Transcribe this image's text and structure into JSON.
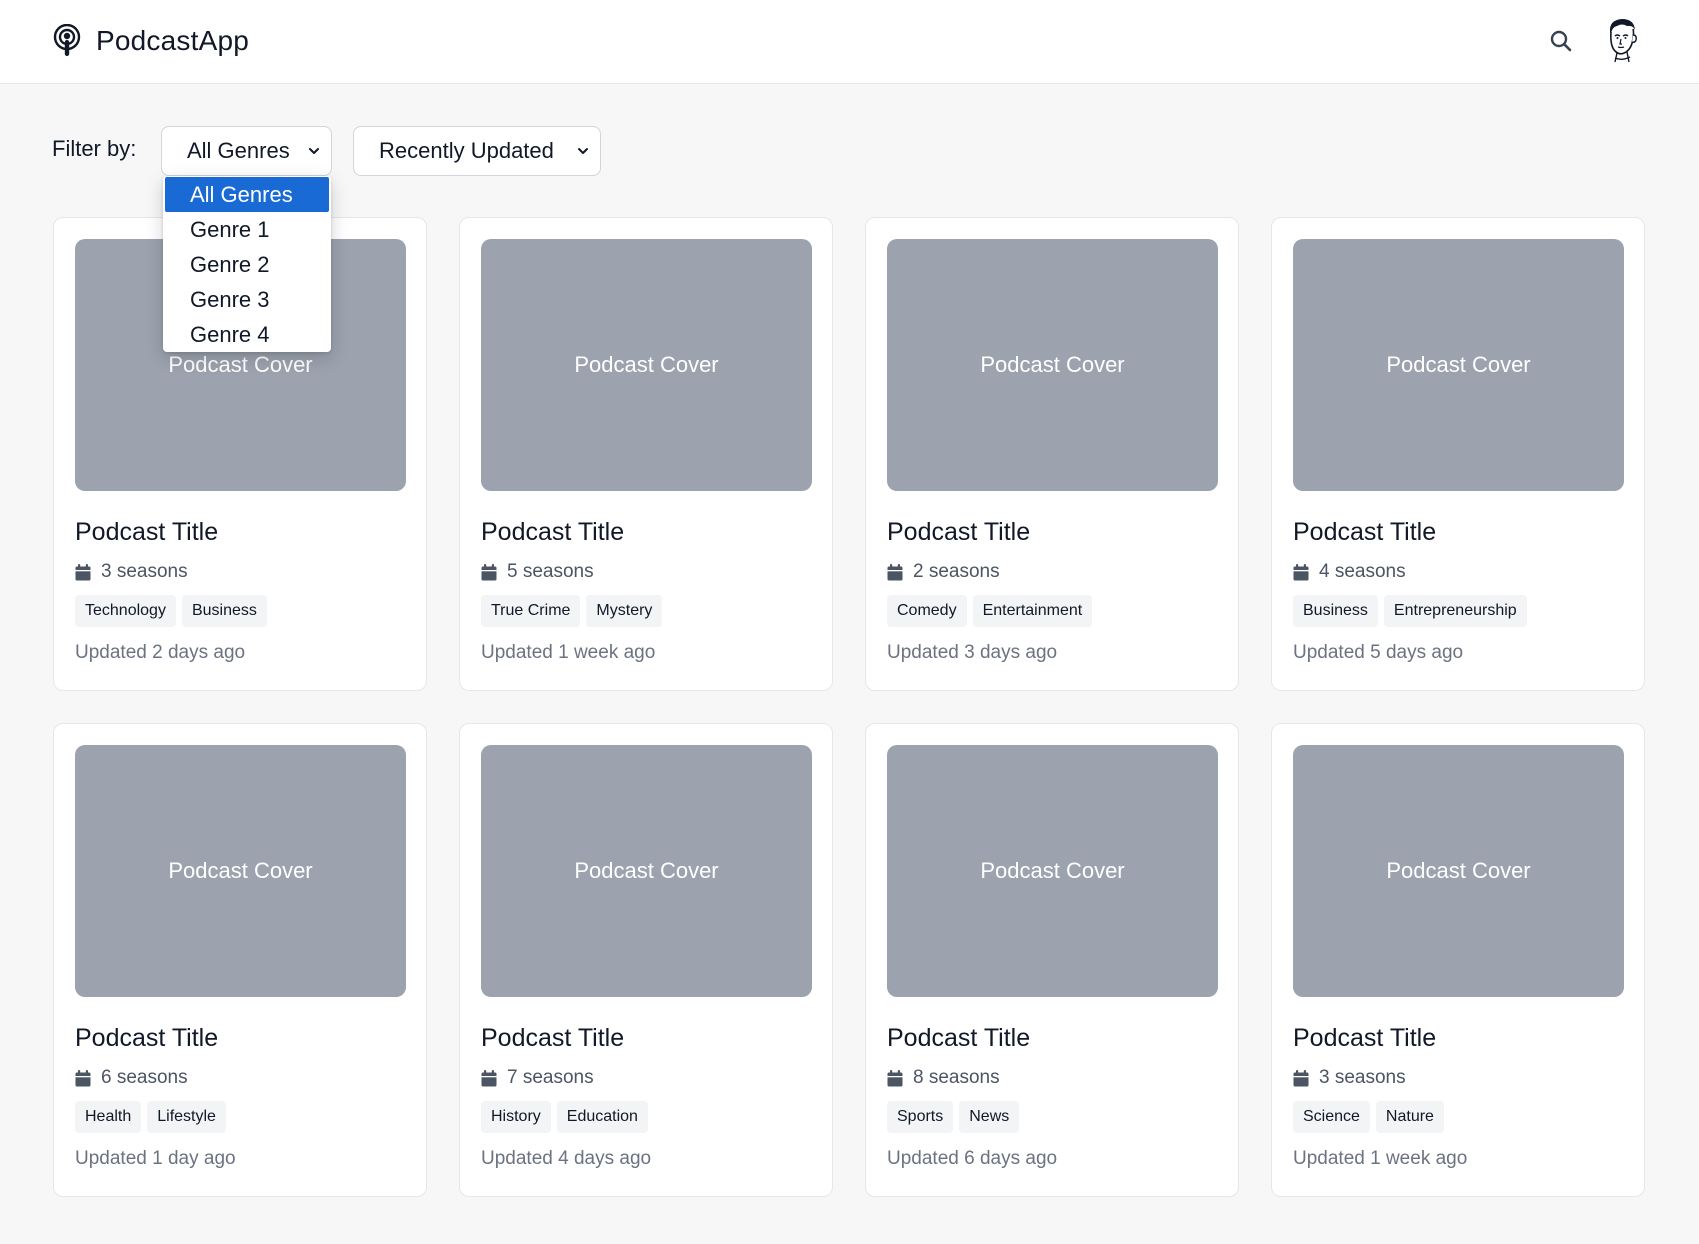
{
  "app": {
    "name": "PodcastApp"
  },
  "filter": {
    "label": "Filter by:",
    "genre_select": {
      "value": "All Genres",
      "options": [
        "All Genres",
        "Genre 1",
        "Genre 2",
        "Genre 3",
        "Genre 4"
      ]
    },
    "sort_select": {
      "value": "Recently Updated"
    }
  },
  "colors": {
    "accent": "#1a6ad6",
    "cover": "#9ca3af",
    "page_bg": "#f7f7f7",
    "tag_bg": "#f3f4f6"
  },
  "podcasts": [
    {
      "cover": "Podcast Cover",
      "title": "Podcast Title",
      "seasons": "3 seasons",
      "tags": [
        "Technology",
        "Business"
      ],
      "updated": "Updated 2 days ago"
    },
    {
      "cover": "Podcast Cover",
      "title": "Podcast Title",
      "seasons": "5 seasons",
      "tags": [
        "True Crime",
        "Mystery"
      ],
      "updated": "Updated 1 week ago"
    },
    {
      "cover": "Podcast Cover",
      "title": "Podcast Title",
      "seasons": "2 seasons",
      "tags": [
        "Comedy",
        "Entertainment"
      ],
      "updated": "Updated 3 days ago"
    },
    {
      "cover": "Podcast Cover",
      "title": "Podcast Title",
      "seasons": "4 seasons",
      "tags": [
        "Business",
        "Entrepreneurship"
      ],
      "updated": "Updated 5 days ago"
    },
    {
      "cover": "Podcast Cover",
      "title": "Podcast Title",
      "seasons": "6 seasons",
      "tags": [
        "Health",
        "Lifestyle"
      ],
      "updated": "Updated 1 day ago"
    },
    {
      "cover": "Podcast Cover",
      "title": "Podcast Title",
      "seasons": "7 seasons",
      "tags": [
        "History",
        "Education"
      ],
      "updated": "Updated 4 days ago"
    },
    {
      "cover": "Podcast Cover",
      "title": "Podcast Title",
      "seasons": "8 seasons",
      "tags": [
        "Sports",
        "News"
      ],
      "updated": "Updated 6 days ago"
    },
    {
      "cover": "Podcast Cover",
      "title": "Podcast Title",
      "seasons": "3 seasons",
      "tags": [
        "Science",
        "Nature"
      ],
      "updated": "Updated 1 week ago"
    }
  ]
}
